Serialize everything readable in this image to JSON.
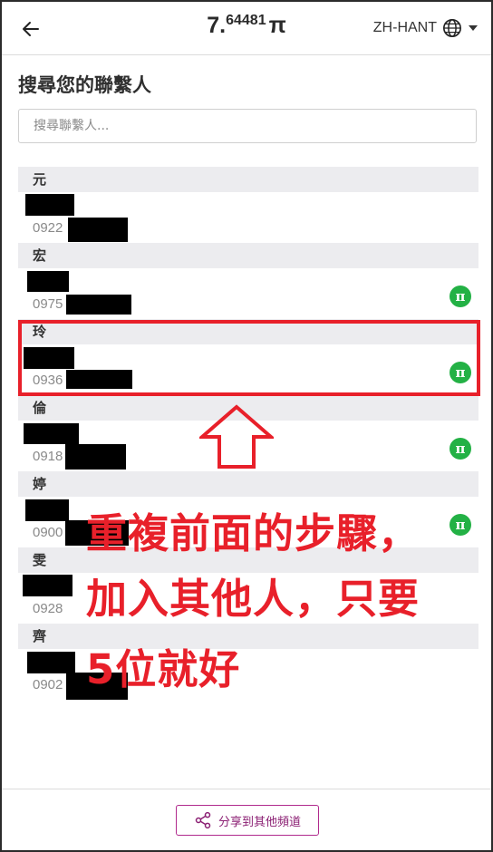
{
  "header": {
    "balance_int": "7.",
    "balance_frac": "64481",
    "currency_symbol": "π",
    "language": "ZH-HANT",
    "icons": {
      "back": "arrow-left-icon",
      "language": "globe-icon",
      "menu": "caret-down-icon"
    }
  },
  "search": {
    "title": "搜尋您的聯繫人",
    "placeholder": "搜尋聯繫人..."
  },
  "contacts": [
    {
      "initial": "元",
      "phone_prefix": "0922",
      "has_pi_badge": false
    },
    {
      "initial": "宏",
      "phone_prefix": "0975",
      "has_pi_badge": true
    },
    {
      "initial": "玲",
      "phone_prefix": "0936",
      "has_pi_badge": true
    },
    {
      "initial": "倫",
      "phone_prefix": "0918",
      "has_pi_badge": true
    },
    {
      "initial": "婷",
      "phone_prefix": "0900",
      "has_pi_badge": true
    },
    {
      "initial": "雯",
      "phone_prefix": "0928",
      "has_pi_badge": false
    },
    {
      "initial": "齊",
      "phone_prefix": "0902",
      "has_pi_badge": false
    }
  ],
  "badge": {
    "symbol": "π",
    "color": "#23b145"
  },
  "annotation": {
    "line1": "重複前面的步驟，",
    "line2": "加入其他人，只要",
    "line3": "5位就好",
    "color": "#e8202a"
  },
  "footer": {
    "share_label": "分享到其他頻道",
    "accent_color": "#b02a8d"
  }
}
